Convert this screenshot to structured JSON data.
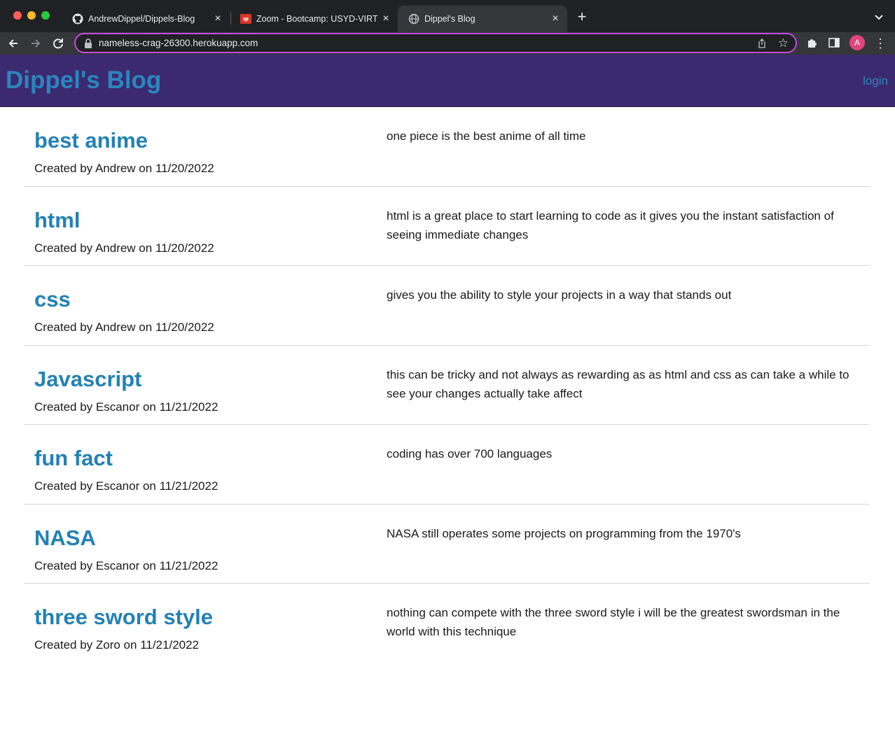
{
  "browser": {
    "tabs": [
      {
        "title": "AndrewDippel/Dippels-Blog",
        "icon": "github-icon",
        "active": false
      },
      {
        "title": "Zoom - Bootcamp: USYD-VIRT",
        "icon": "zoom-favicon-icon",
        "active": false
      },
      {
        "title": "Dippel's Blog",
        "icon": "globe-icon",
        "active": true
      }
    ],
    "url": "nameless-crag-26300.herokuapp.com",
    "profile_initial": "A",
    "accent_color": "#c54ae0"
  },
  "site": {
    "title": "Dippel's Blog",
    "login_label": "login",
    "header_color": "#3b2a6f",
    "link_color": "#2b86be"
  },
  "posts": [
    {
      "title": "best anime",
      "meta": "Created by Andrew on 11/20/2022",
      "body": "one piece is the best anime of all time"
    },
    {
      "title": "html",
      "meta": "Created by Andrew on 11/20/2022",
      "body": "html is a great place to start learning to code as it gives you the instant satisfaction of seeing immediate changes"
    },
    {
      "title": "css",
      "meta": "Created by Andrew on 11/20/2022",
      "body": "gives you the ability to style your projects in a way that stands out"
    },
    {
      "title": "Javascript",
      "meta": "Created by Escanor on 11/21/2022",
      "body": "this can be tricky and not always as rewarding as as html and css as can take a while to see your changes actually take affect"
    },
    {
      "title": "fun fact",
      "meta": "Created by Escanor on 11/21/2022",
      "body": "coding has over 700 languages"
    },
    {
      "title": "NASA",
      "meta": "Created by Escanor on 11/21/2022",
      "body": "NASA still operates some projects on programming from the 1970's"
    },
    {
      "title": "three sword style",
      "meta": "Created by Zoro on 11/21/2022",
      "body": "nothing can compete with the three sword style i will be the greatest swordsman in the world with this technique"
    }
  ]
}
